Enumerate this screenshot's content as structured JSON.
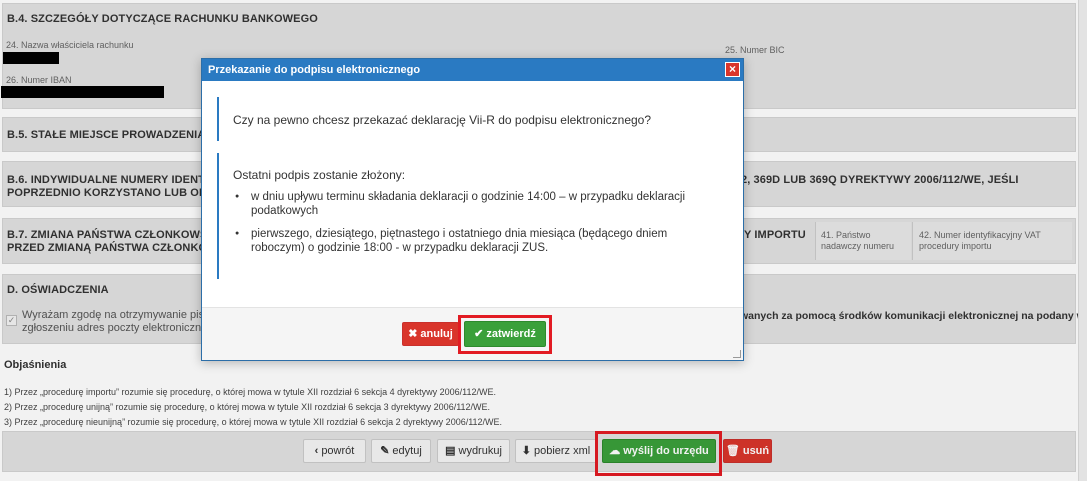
{
  "form": {
    "b4": {
      "title": "B.4. SZCZEGÓŁY DOTYCZĄCE RACHUNKU BANKOWEGO",
      "f24": "24. Nazwa właściciela rachunku",
      "f25": "25. Numer BIC",
      "f26": "26. Numer IBAN"
    },
    "b5": {
      "title": "B.5. STAŁE MIEJSCE PROWADZENIA"
    },
    "b6": {
      "title_left_1": "B.6. INDYWIDUALNE NUMERY IDENTY",
      "title_left_2": "POPRZEDNIO KORZYSTANO LUB OB",
      "title_right": "2, 369D LUB 369Q DYREKTYWY 2006/112/WE, JEŚLI"
    },
    "b7": {
      "title_left_1": "B.7. ZMIANA PAŃSTWA CZŁONKOWS",
      "title_left_2": "PRZED ZMIANĄ PAŃSTWA CZŁONKO",
      "title_right": "Y IMPORTU",
      "f41_1": "41. Państwo",
      "f41_2": "nadawczy numeru",
      "f42_1": "42. Numer identyfikacyjny VAT",
      "f42_2": "procedury importu"
    },
    "d": {
      "title": "D. OŚWIADCZENIA",
      "text_left_1": "Wyrażam zgodę na otrzymywanie pis",
      "text_left_2": "zgłoszeniu adres poczty elektroniczne",
      "text_right": "wanych za pomocą środków komunikacji elektronicznej na podany w"
    },
    "explanations": {
      "title": "Objaśnienia",
      "lines": [
        "1) Przez „procedurę importu” rozumie się procedurę, o której mowa w tytule XII rozdział 6 sekcja 4 dyrektywy 2006/112/WE.",
        "2) Przez „procedurę unijną” rozumie się procedurę, o której mowa w tytule XII rozdział 6 sekcja 3 dyrektywy 2006/112/WE.",
        "3) Przez „procedurę nieunijną” rozumie się procedurę, o której mowa w tytule XII rozdział 6 sekcja 2 dyrektywy 2006/112/WE."
      ]
    }
  },
  "toolbar": {
    "back": "powrót",
    "edit": "edytuj",
    "print": "wydrukuj",
    "xml": "pobierz xml",
    "send": "wyślij do urzędu",
    "delete": "usuń"
  },
  "modal": {
    "title": "Przekazanie do podpisu elektronicznego",
    "close": "×",
    "question": "Czy na pewno chcesz przekazać deklarację Vii-R do podpisu elektronicznego?",
    "info_head": "Ostatni podpis zostanie złożony:",
    "bullets": [
      "w dniu upływu terminu składania deklaracji o godzinie 14:00 – w przypadku deklaracji podatkowych",
      "pierwszego, dziesiątego, piętnastego i ostatniego dnia miesiąca (będącego dniem roboczym) o godzinie 18:00 - w przypadku deklaracji ZUS."
    ],
    "cancel": "anuluj",
    "confirm": "zatwierdź"
  },
  "colors": {
    "accent_blue": "#2a7ac2",
    "danger_red": "#d9352b",
    "success_green": "#3aa03a",
    "highlight_red": "#e21b23"
  }
}
